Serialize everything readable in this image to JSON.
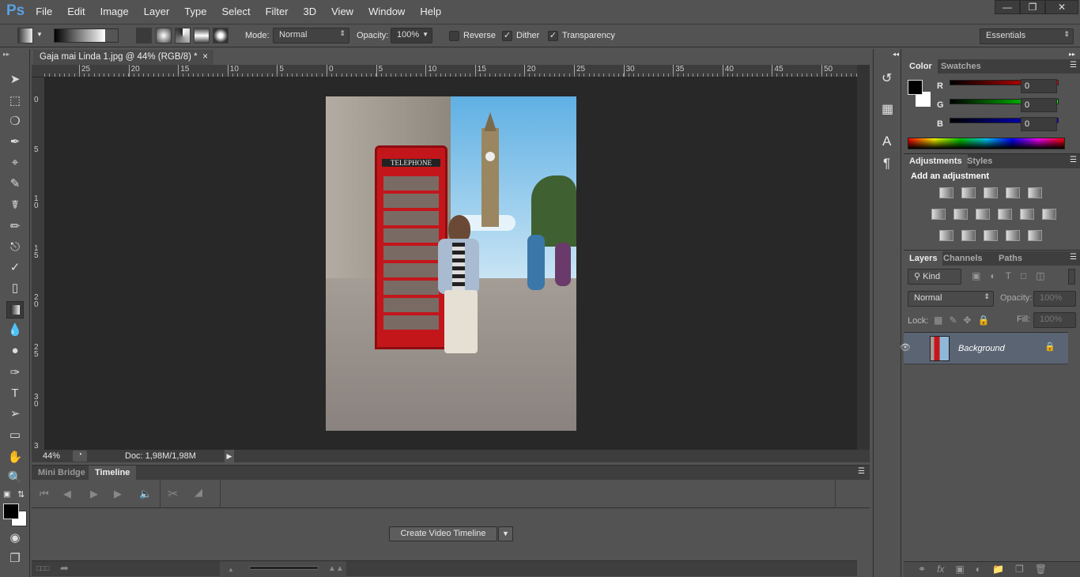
{
  "app": {
    "logo": "Ps",
    "menu": [
      "File",
      "Edit",
      "Image",
      "Layer",
      "Type",
      "Select",
      "Filter",
      "3D",
      "View",
      "Window",
      "Help"
    ],
    "window_controls": [
      "minimize",
      "restore",
      "close"
    ]
  },
  "options": {
    "mode_label": "Mode:",
    "mode_value": "Normal",
    "opacity_label": "Opacity:",
    "opacity_value": "100%",
    "reverse_label": "Reverse",
    "reverse_checked": false,
    "dither_label": "Dither",
    "dither_checked": true,
    "transparency_label": "Transparency",
    "transparency_checked": true,
    "workspace": "Essentials"
  },
  "document": {
    "tab_title": "Gaja mai Linda 1.jpg @ 44% (RGB/8) *",
    "zoom": "44%",
    "doc_info": "Doc: 1,98M/1,98M",
    "hruler_labels": [
      "25",
      "20",
      "15",
      "10",
      "5",
      "0",
      "5",
      "10",
      "15",
      "20",
      "25",
      "30",
      "35",
      "40",
      "45",
      "50"
    ],
    "vruler_labels": [
      "0",
      "5",
      "1 0",
      "1 5",
      "2 0",
      "2 5",
      "3 0",
      "3"
    ]
  },
  "photo": {
    "sign": "TELEPHONE"
  },
  "bottom_panel": {
    "tabs": [
      "Mini Bridge",
      "Timeline"
    ],
    "active_tab": "Timeline",
    "create_button": "Create Video Timeline"
  },
  "color_panel": {
    "tabs": [
      "Color",
      "Swatches"
    ],
    "r_label": "R",
    "g_label": "G",
    "b_label": "B",
    "r": "0",
    "g": "0",
    "b": "0",
    "foreground": "#000000",
    "background": "#ffffff"
  },
  "adjustments_panel": {
    "tabs": [
      "Adjustments",
      "Styles"
    ],
    "heading": "Add an adjustment"
  },
  "layers_panel": {
    "tabs": [
      "Layers",
      "Channels",
      "Paths"
    ],
    "filter": "Kind",
    "blend_mode": "Normal",
    "opacity_label": "Opacity:",
    "opacity": "100%",
    "lock_label": "Lock:",
    "fill_label": "Fill:",
    "fill": "100%",
    "layers": [
      {
        "name": "Background",
        "visible": true,
        "locked": true
      }
    ]
  }
}
